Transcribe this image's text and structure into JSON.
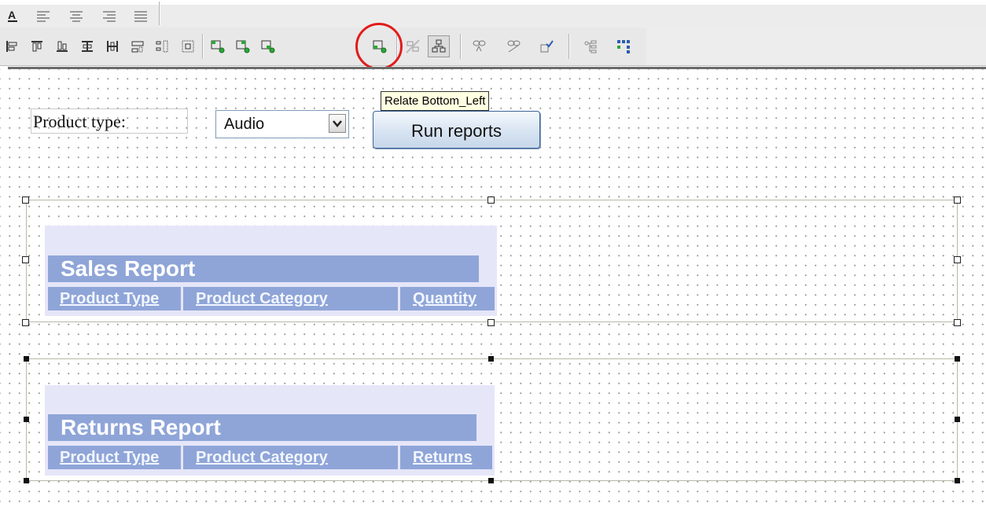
{
  "toolbar": {
    "row1_icons": [
      "font-color-icon",
      "align-left-icon",
      "align-center-icon",
      "align-right-icon",
      "justify-icon"
    ],
    "row2_icons": [
      "align-left-edges-icon",
      "align-tops-icon",
      "align-bottoms-icon",
      "center-vertical-icon",
      "center-horizontal-icon",
      "align-middle-icon",
      "distribute-vertical-icon",
      "distribute-horizontal-icon",
      "relate-top-left-icon",
      "relate-top-right-icon",
      "relate-bottom-right-icon",
      "relate-bottom-left-icon",
      "unrelate-icon",
      "relate-grid-icon",
      "connect-icon",
      "disconnect-icon",
      "connection-properties-icon",
      "tree-view-icon",
      "layout-grid-icon"
    ],
    "highlight_color": "#e21b1b"
  },
  "tooltip": {
    "text": "Relate Bottom_Left"
  },
  "form": {
    "label": "Product type:",
    "select_value": "Audio",
    "run_button": "Run reports"
  },
  "reports": {
    "sales": {
      "title": "Sales Report",
      "columns": [
        "Product Type",
        "Product Category",
        "Quantity"
      ]
    },
    "returns": {
      "title": "Returns Report",
      "columns": [
        "Product Type",
        "Product Category",
        "Returns"
      ]
    }
  },
  "colors": {
    "report_header_bg": "#8fa5d8",
    "report_panel_bg": "#e6e6f9",
    "tooltip_bg": "#ffffe1"
  }
}
